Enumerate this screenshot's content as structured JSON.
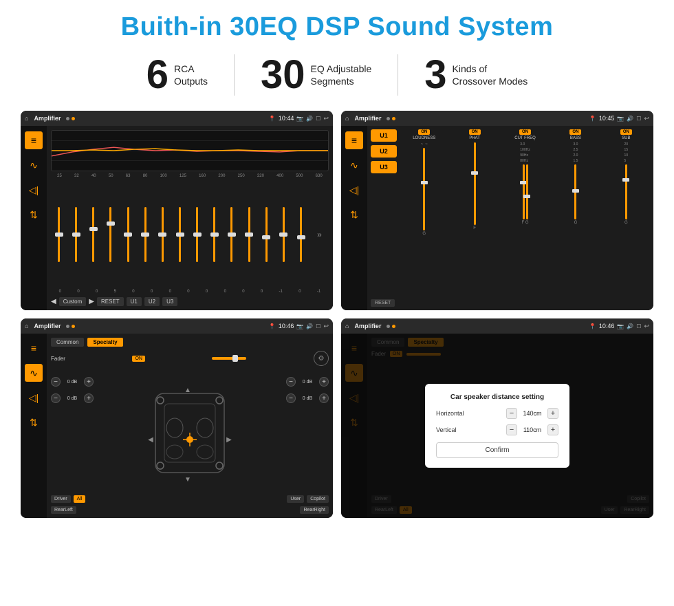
{
  "page": {
    "title": "Buith-in 30EQ DSP Sound System"
  },
  "stats": [
    {
      "number": "6",
      "label": "RCA\nOutputs"
    },
    {
      "number": "30",
      "label": "EQ Adjustable\nSegments"
    },
    {
      "number": "3",
      "label": "Kinds of\nCrossover Modes"
    }
  ],
  "screens": {
    "screen1": {
      "topbar": {
        "home": "⌂",
        "title": "Amplifier",
        "time": "10:44"
      },
      "eq_freqs": [
        "25",
        "32",
        "40",
        "50",
        "63",
        "80",
        "100",
        "125",
        "160",
        "200",
        "250",
        "320",
        "400",
        "500",
        "630"
      ],
      "eq_values": [
        "0",
        "0",
        "0",
        "5",
        "0",
        "0",
        "0",
        "0",
        "0",
        "0",
        "0",
        "0",
        "-1",
        "0",
        "-1"
      ],
      "buttons": [
        "Custom",
        "RESET",
        "U1",
        "U2",
        "U3"
      ]
    },
    "screen2": {
      "topbar": {
        "home": "⌂",
        "title": "Amplifier",
        "time": "10:45"
      },
      "channels": [
        {
          "on": "ON",
          "name": "LOUDNESS"
        },
        {
          "on": "ON",
          "name": "PHAT"
        },
        {
          "on": "ON",
          "name": "CUT FREQ"
        },
        {
          "on": "ON",
          "name": "BASS"
        },
        {
          "on": "ON",
          "name": "SUB"
        }
      ],
      "u_buttons": [
        "U1",
        "U2",
        "U3"
      ],
      "reset_label": "RESET"
    },
    "screen3": {
      "topbar": {
        "home": "⌂",
        "title": "Amplifier",
        "time": "10:46"
      },
      "tabs": [
        "Common",
        "Specialty"
      ],
      "active_tab": "Specialty",
      "fader_label": "Fader",
      "fader_on": "ON",
      "vol_labels": [
        "0 dB",
        "0 dB",
        "0 dB",
        "0 dB"
      ],
      "bottom_buttons": [
        "Driver",
        "RearLeft",
        "All",
        "User",
        "Copilot",
        "RearRight"
      ]
    },
    "screen4": {
      "topbar": {
        "home": "⌂",
        "title": "Amplifier",
        "time": "10:46"
      },
      "tabs": [
        "Common",
        "Specialty"
      ],
      "active_tab": "Specialty",
      "dialog": {
        "title": "Car speaker distance setting",
        "fields": [
          {
            "label": "Horizontal",
            "value": "140cm"
          },
          {
            "label": "Vertical",
            "value": "110cm"
          }
        ],
        "confirm_label": "Confirm"
      },
      "bottom_buttons": [
        "Driver",
        "RearLeft",
        "All",
        "User",
        "Copilot",
        "RearRight"
      ]
    }
  },
  "icons": {
    "home": "⌂",
    "eq_icon": "≡",
    "wave_icon": "∿",
    "volume_icon": "◁",
    "arrows_icon": "⇅",
    "play": "▶",
    "prev": "◀",
    "minus": "−",
    "plus": "+"
  }
}
